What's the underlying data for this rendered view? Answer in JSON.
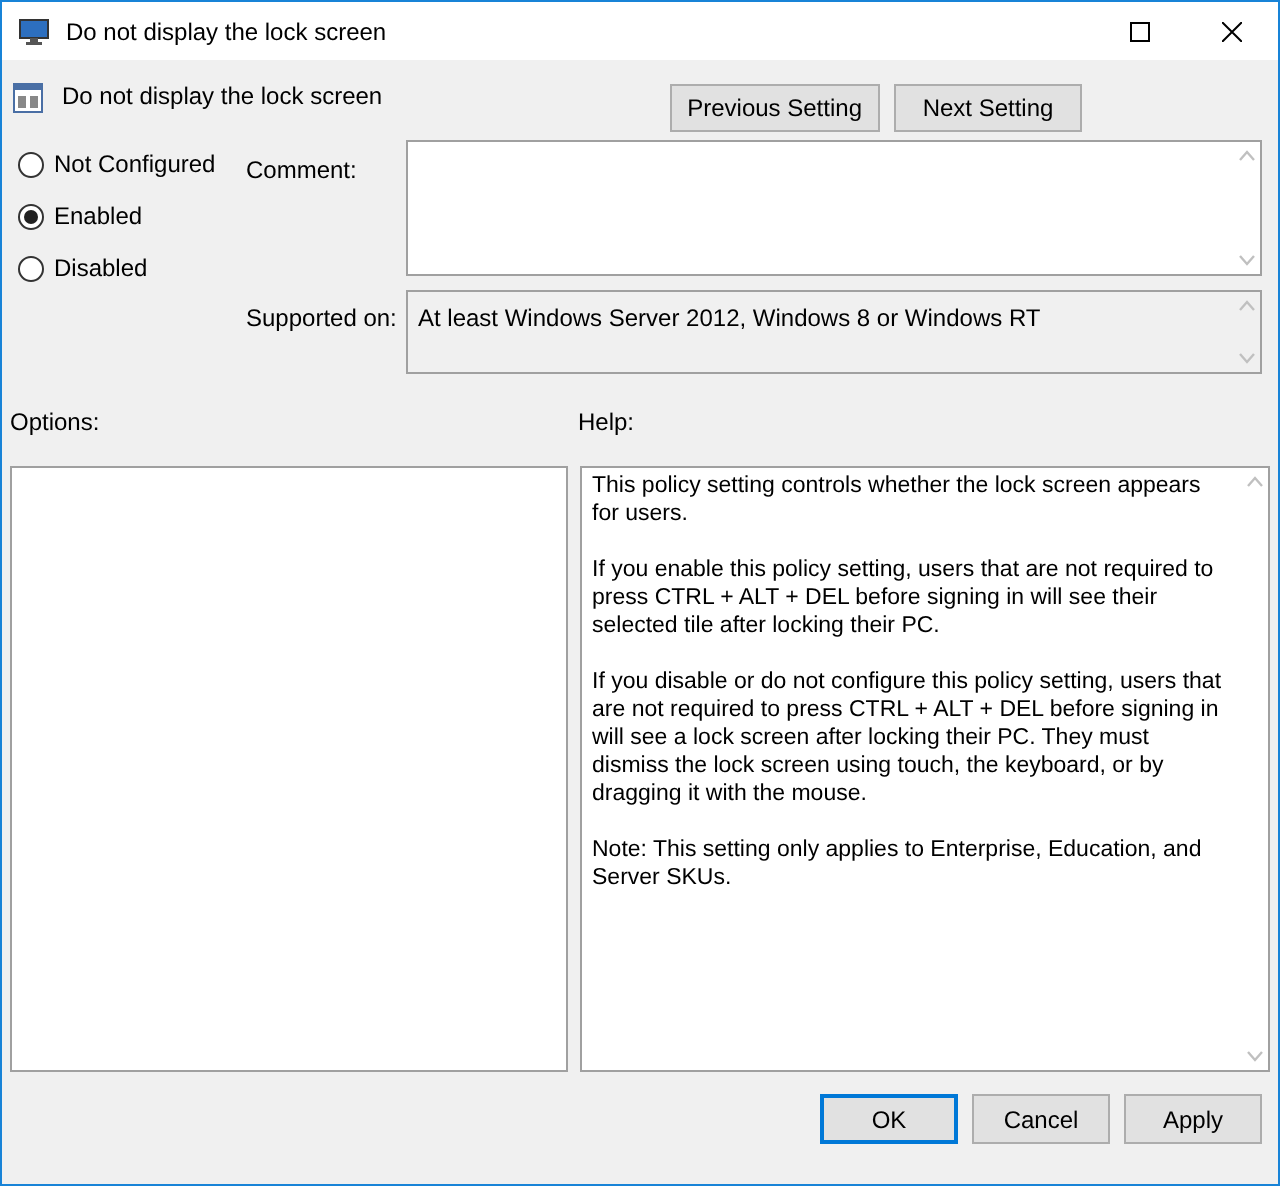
{
  "window": {
    "title": "Do not display the lock screen"
  },
  "header": {
    "title": "Do not display the lock screen"
  },
  "nav_buttons": [
    "Previous Setting",
    "Next Setting"
  ],
  "options": [
    {
      "label": "Not Configured",
      "selected": false
    },
    {
      "label": "Enabled",
      "selected": true
    },
    {
      "label": "Disabled",
      "selected": false
    }
  ],
  "comment": {
    "label": "Comment:"
  },
  "supported_on": {
    "label": "Supported on:",
    "value": "At least Windows Server 2012, Windows 8 or Windows RT"
  },
  "options_panel": {
    "label": "Options:"
  },
  "help_panel": {
    "label": "Help:",
    "paragraphs": [
      "This policy setting controls whether the lock screen appears for users.",
      "If you enable this policy setting, users that are not required to press CTRL + ALT + DEL before signing in will see their selected tile after locking their PC.",
      "If you disable or do not configure this policy setting, users that are not required to press CTRL + ALT + DEL before signing in will see a lock screen after locking their PC. They must dismiss the lock screen using touch, the keyboard, or by dragging it with the mouse.",
      "Note: This setting only applies to Enterprise, Education, and Server SKUs."
    ]
  },
  "buttons": [
    {
      "label": "OK",
      "kind": "default"
    },
    {
      "label": "Cancel",
      "kind": "normal"
    },
    {
      "label": "Apply",
      "kind": "normal"
    }
  ]
}
